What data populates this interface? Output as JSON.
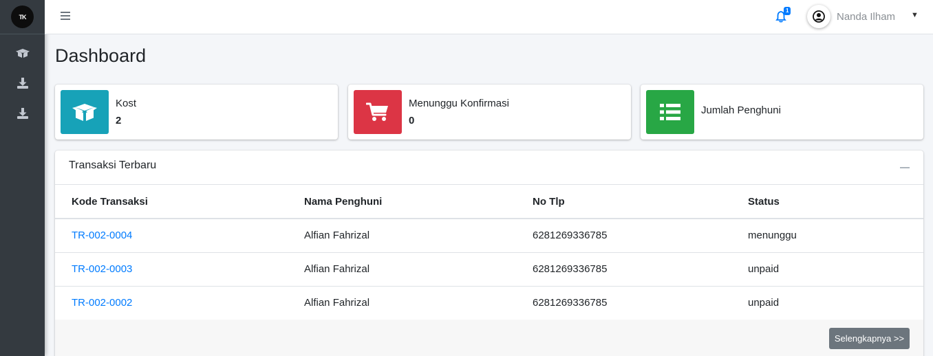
{
  "brand": {
    "logo_text": "TK"
  },
  "sidebar": {
    "items": [
      {
        "icon": "box-open-icon"
      },
      {
        "icon": "download-icon"
      },
      {
        "icon": "download-icon"
      }
    ]
  },
  "topbar": {
    "notification_count": "1",
    "user_name": "Nanda Ilham"
  },
  "page": {
    "title": "Dashboard"
  },
  "info_boxes": [
    {
      "label": "Kost",
      "value": "2",
      "color": "#17a2b8",
      "icon": "box-open-icon"
    },
    {
      "label": "Menunggu Konfirmasi",
      "value": "0",
      "color": "#dc3545",
      "icon": "shopping-cart-icon"
    },
    {
      "label": "Jumlah Penghuni",
      "value": "",
      "color": "#28a745",
      "icon": "list-icon"
    }
  ],
  "transactions": {
    "title": "Transaksi Terbaru",
    "columns": [
      "Kode Transaksi",
      "Nama Penghuni",
      "No Tlp",
      "Status"
    ],
    "rows": [
      {
        "kode": "TR-002-0004",
        "nama": "Alfian Fahrizal",
        "tlp": "6281269336785",
        "status": "menunggu"
      },
      {
        "kode": "TR-002-0003",
        "nama": "Alfian Fahrizal",
        "tlp": "6281269336785",
        "status": "unpaid"
      },
      {
        "kode": "TR-002-0002",
        "nama": "Alfian Fahrizal",
        "tlp": "6281269336785",
        "status": "unpaid"
      }
    ],
    "more_label": "Selengkapnya >>"
  },
  "colors": {
    "link": "#007bff",
    "sidebar_bg": "#343a40",
    "button_secondary": "#6c757d"
  }
}
